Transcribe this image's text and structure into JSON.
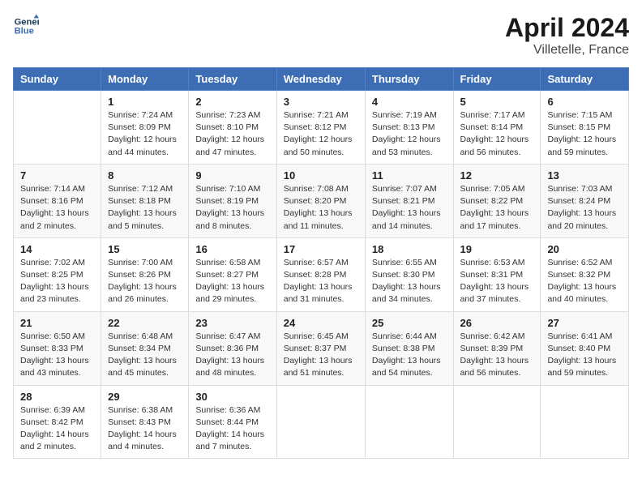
{
  "header": {
    "logo_line1": "General",
    "logo_line2": "Blue",
    "title": "April 2024",
    "location": "Villetelle, France"
  },
  "weekdays": [
    "Sunday",
    "Monday",
    "Tuesday",
    "Wednesday",
    "Thursday",
    "Friday",
    "Saturday"
  ],
  "weeks": [
    [
      {
        "day": "",
        "sunrise": "",
        "sunset": "",
        "daylight": ""
      },
      {
        "day": "1",
        "sunrise": "Sunrise: 7:24 AM",
        "sunset": "Sunset: 8:09 PM",
        "daylight": "Daylight: 12 hours and 44 minutes."
      },
      {
        "day": "2",
        "sunrise": "Sunrise: 7:23 AM",
        "sunset": "Sunset: 8:10 PM",
        "daylight": "Daylight: 12 hours and 47 minutes."
      },
      {
        "day": "3",
        "sunrise": "Sunrise: 7:21 AM",
        "sunset": "Sunset: 8:12 PM",
        "daylight": "Daylight: 12 hours and 50 minutes."
      },
      {
        "day": "4",
        "sunrise": "Sunrise: 7:19 AM",
        "sunset": "Sunset: 8:13 PM",
        "daylight": "Daylight: 12 hours and 53 minutes."
      },
      {
        "day": "5",
        "sunrise": "Sunrise: 7:17 AM",
        "sunset": "Sunset: 8:14 PM",
        "daylight": "Daylight: 12 hours and 56 minutes."
      },
      {
        "day": "6",
        "sunrise": "Sunrise: 7:15 AM",
        "sunset": "Sunset: 8:15 PM",
        "daylight": "Daylight: 12 hours and 59 minutes."
      }
    ],
    [
      {
        "day": "7",
        "sunrise": "Sunrise: 7:14 AM",
        "sunset": "Sunset: 8:16 PM",
        "daylight": "Daylight: 13 hours and 2 minutes."
      },
      {
        "day": "8",
        "sunrise": "Sunrise: 7:12 AM",
        "sunset": "Sunset: 8:18 PM",
        "daylight": "Daylight: 13 hours and 5 minutes."
      },
      {
        "day": "9",
        "sunrise": "Sunrise: 7:10 AM",
        "sunset": "Sunset: 8:19 PM",
        "daylight": "Daylight: 13 hours and 8 minutes."
      },
      {
        "day": "10",
        "sunrise": "Sunrise: 7:08 AM",
        "sunset": "Sunset: 8:20 PM",
        "daylight": "Daylight: 13 hours and 11 minutes."
      },
      {
        "day": "11",
        "sunrise": "Sunrise: 7:07 AM",
        "sunset": "Sunset: 8:21 PM",
        "daylight": "Daylight: 13 hours and 14 minutes."
      },
      {
        "day": "12",
        "sunrise": "Sunrise: 7:05 AM",
        "sunset": "Sunset: 8:22 PM",
        "daylight": "Daylight: 13 hours and 17 minutes."
      },
      {
        "day": "13",
        "sunrise": "Sunrise: 7:03 AM",
        "sunset": "Sunset: 8:24 PM",
        "daylight": "Daylight: 13 hours and 20 minutes."
      }
    ],
    [
      {
        "day": "14",
        "sunrise": "Sunrise: 7:02 AM",
        "sunset": "Sunset: 8:25 PM",
        "daylight": "Daylight: 13 hours and 23 minutes."
      },
      {
        "day": "15",
        "sunrise": "Sunrise: 7:00 AM",
        "sunset": "Sunset: 8:26 PM",
        "daylight": "Daylight: 13 hours and 26 minutes."
      },
      {
        "day": "16",
        "sunrise": "Sunrise: 6:58 AM",
        "sunset": "Sunset: 8:27 PM",
        "daylight": "Daylight: 13 hours and 29 minutes."
      },
      {
        "day": "17",
        "sunrise": "Sunrise: 6:57 AM",
        "sunset": "Sunset: 8:28 PM",
        "daylight": "Daylight: 13 hours and 31 minutes."
      },
      {
        "day": "18",
        "sunrise": "Sunrise: 6:55 AM",
        "sunset": "Sunset: 8:30 PM",
        "daylight": "Daylight: 13 hours and 34 minutes."
      },
      {
        "day": "19",
        "sunrise": "Sunrise: 6:53 AM",
        "sunset": "Sunset: 8:31 PM",
        "daylight": "Daylight: 13 hours and 37 minutes."
      },
      {
        "day": "20",
        "sunrise": "Sunrise: 6:52 AM",
        "sunset": "Sunset: 8:32 PM",
        "daylight": "Daylight: 13 hours and 40 minutes."
      }
    ],
    [
      {
        "day": "21",
        "sunrise": "Sunrise: 6:50 AM",
        "sunset": "Sunset: 8:33 PM",
        "daylight": "Daylight: 13 hours and 43 minutes."
      },
      {
        "day": "22",
        "sunrise": "Sunrise: 6:48 AM",
        "sunset": "Sunset: 8:34 PM",
        "daylight": "Daylight: 13 hours and 45 minutes."
      },
      {
        "day": "23",
        "sunrise": "Sunrise: 6:47 AM",
        "sunset": "Sunset: 8:36 PM",
        "daylight": "Daylight: 13 hours and 48 minutes."
      },
      {
        "day": "24",
        "sunrise": "Sunrise: 6:45 AM",
        "sunset": "Sunset: 8:37 PM",
        "daylight": "Daylight: 13 hours and 51 minutes."
      },
      {
        "day": "25",
        "sunrise": "Sunrise: 6:44 AM",
        "sunset": "Sunset: 8:38 PM",
        "daylight": "Daylight: 13 hours and 54 minutes."
      },
      {
        "day": "26",
        "sunrise": "Sunrise: 6:42 AM",
        "sunset": "Sunset: 8:39 PM",
        "daylight": "Daylight: 13 hours and 56 minutes."
      },
      {
        "day": "27",
        "sunrise": "Sunrise: 6:41 AM",
        "sunset": "Sunset: 8:40 PM",
        "daylight": "Daylight: 13 hours and 59 minutes."
      }
    ],
    [
      {
        "day": "28",
        "sunrise": "Sunrise: 6:39 AM",
        "sunset": "Sunset: 8:42 PM",
        "daylight": "Daylight: 14 hours and 2 minutes."
      },
      {
        "day": "29",
        "sunrise": "Sunrise: 6:38 AM",
        "sunset": "Sunset: 8:43 PM",
        "daylight": "Daylight: 14 hours and 4 minutes."
      },
      {
        "day": "30",
        "sunrise": "Sunrise: 6:36 AM",
        "sunset": "Sunset: 8:44 PM",
        "daylight": "Daylight: 14 hours and 7 minutes."
      },
      {
        "day": "",
        "sunrise": "",
        "sunset": "",
        "daylight": ""
      },
      {
        "day": "",
        "sunrise": "",
        "sunset": "",
        "daylight": ""
      },
      {
        "day": "",
        "sunrise": "",
        "sunset": "",
        "daylight": ""
      },
      {
        "day": "",
        "sunrise": "",
        "sunset": "",
        "daylight": ""
      }
    ]
  ]
}
